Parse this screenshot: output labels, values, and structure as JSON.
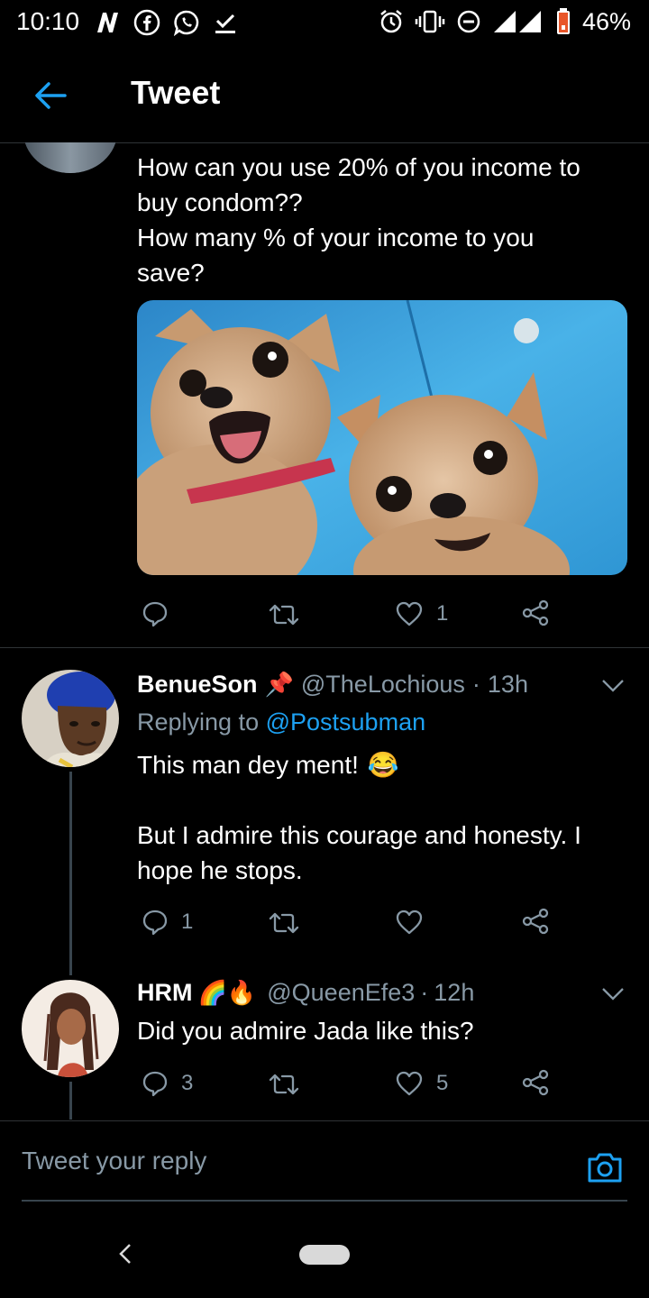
{
  "status_bar": {
    "time": "10:10",
    "battery": "46%",
    "network": "3G",
    "icons_left": [
      "n-logo-icon",
      "facebook-icon",
      "whatsapp-icon",
      "download-check-icon"
    ],
    "icons_right": [
      "alarm-icon",
      "vibrate-icon",
      "dnd-icon",
      "signal-icon",
      "battery-icon"
    ]
  },
  "header": {
    "title": "Tweet"
  },
  "main_tweet": {
    "lines": [
      "How can you use 20% of you income to",
      "buy condom??",
      "How many % of your income to you",
      "save?"
    ],
    "likes": "1"
  },
  "replies": [
    {
      "name": "BenueSon",
      "name_emoji": "📌",
      "handle": "@TheLochious",
      "time": "13h",
      "replying_prefix": "Replying to",
      "replying_to": "@Postsubman",
      "text_line1": "This man dey ment!",
      "text_emoji": "😂",
      "text_line2": "But I admire this courage and honesty. I",
      "text_line3": "hope he stops.",
      "replies_count": "1"
    },
    {
      "name": "HRM",
      "name_emoji": "🌈🔥",
      "handle": "@QueenEfe3",
      "time": "12h",
      "text_line1": "Did you admire Jada like this?",
      "replies_count": "3",
      "likes": "5"
    }
  ],
  "compose": {
    "placeholder": "Tweet your reply"
  },
  "colors": {
    "accent": "#1da1f2",
    "muted": "#8899a6",
    "divider": "#2f3336",
    "background": "#000000"
  }
}
